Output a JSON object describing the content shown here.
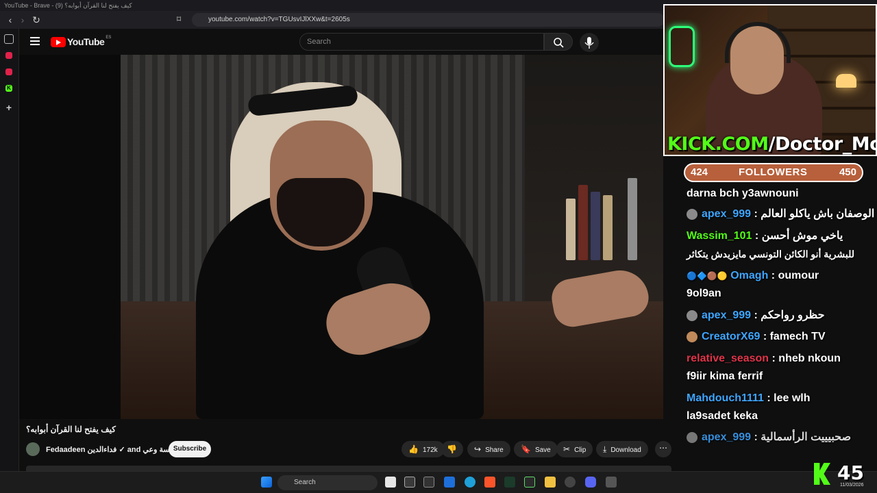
{
  "browser": {
    "window_title": "YouTube - Brave - كيف يفتح لنا القرآن أبوابه؟ (9)",
    "url": "youtube.com/watch?v=TGUsvIJlXXw&t=2605s"
  },
  "youtube": {
    "logo_text": "YouTube",
    "logo_country": "ES",
    "search_placeholder": "Search",
    "video_title": "كيف يفتح لنا القرآن أبوابه؟",
    "channel_name": "Fedaadeen فداءالدين ✓ and مؤسسة وعي",
    "subscribe_label": "Subscribe",
    "actions": {
      "likes": "172k",
      "share": "Share",
      "save": "Save",
      "clip": "Clip",
      "download": "Download"
    }
  },
  "stream_overlay": {
    "kick_banner_prefix": "KICK.COM",
    "kick_banner_rest": "/Doctor_Mohamed",
    "followers_current": "424",
    "followers_label": "FOLLOWERS",
    "followers_goal": "450",
    "chat": [
      {
        "user": "",
        "message": "darna bch y3awnouni",
        "user_color": "#ffffff"
      },
      {
        "user": "apex_999",
        "message": "الوصفان باش ياكلو العالم",
        "user_color": "#3ea6ff"
      },
      {
        "user": "Wassim_101",
        "message": "ياخي موش أحسن",
        "user_color": "#53fc18"
      },
      {
        "user": "",
        "message": "للبشرية أنو الكائن التونسي مايزيدش يتكاثر",
        "user_color": "#ffffff"
      },
      {
        "user": "Omagh",
        "message": "oumour",
        "user_color": "#3ea6ff"
      },
      {
        "user": "",
        "message": "9ol9an",
        "user_color": "#ffffff"
      },
      {
        "user": "apex_999",
        "message": "حظرو رواحكم",
        "user_color": "#3ea6ff"
      },
      {
        "user": "CreatorX69",
        "message": "famech TV",
        "user_color": "#3ea6ff"
      },
      {
        "user": "relative_season",
        "message": "nheb nkoun",
        "user_color": "#e0344a"
      },
      {
        "user": "",
        "message": "f9iir kima ferrif",
        "user_color": "#ffffff"
      },
      {
        "user": "Mahdouch1111",
        "message": "lee wlh",
        "user_color": "#3ea6ff"
      },
      {
        "user": "",
        "message": "la9sadet keka",
        "user_color": "#ffffff"
      },
      {
        "user": "apex_999",
        "message": "صحبيييت الرأسمالية",
        "user_color": "#3ea6ff"
      }
    ],
    "viewer_count": "45"
  },
  "taskbar": {
    "search_label": "Search",
    "date": "11/03/2026"
  },
  "colors": {
    "kick_green": "#53fc18",
    "yt_red": "#ff0000",
    "followers_bar": "#b8603c"
  }
}
